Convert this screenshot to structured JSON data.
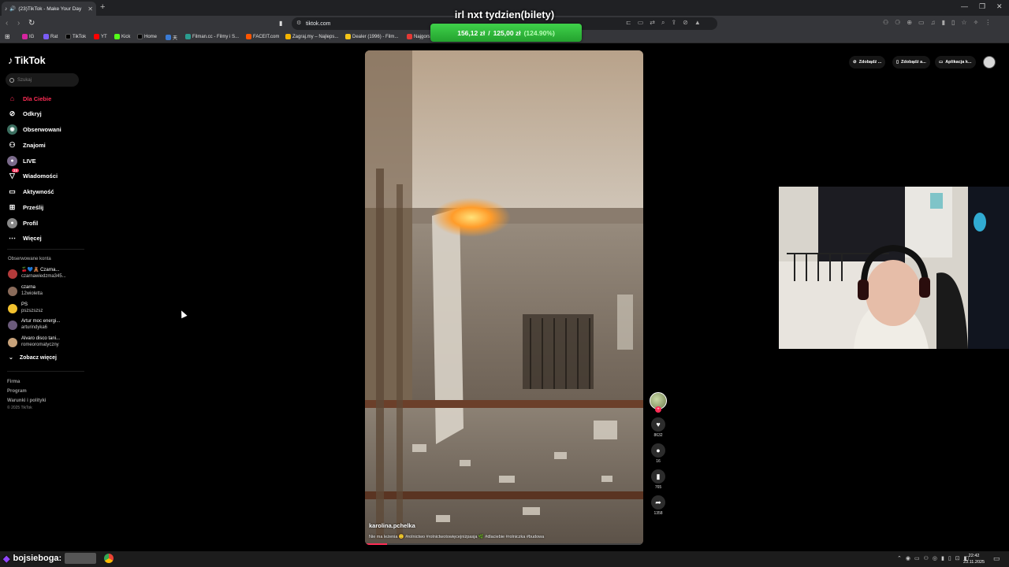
{
  "browser": {
    "tab_title": "(23)TikTok - Make Your Day",
    "url": "tiktok.com",
    "bookmarks": [
      {
        "label": "IG",
        "color": "#d6249f"
      },
      {
        "label": "Rat",
        "color": "#7a5cf5"
      },
      {
        "label": "TikTok",
        "color": "#000000"
      },
      {
        "label": "YT",
        "color": "#ff0000"
      },
      {
        "label": "Kick",
        "color": "#53fc18"
      },
      {
        "label": "Home",
        "color": "#000000"
      },
      {
        "label": "天",
        "color": "#3a7bd5"
      },
      {
        "label": "Filman.cc - Filmy i S...",
        "color": "#2a9d8f"
      },
      {
        "label": "FACEIT.com",
        "color": "#ff5500"
      },
      {
        "label": "Zagraj.my – Najleps...",
        "color": "#f4b400"
      },
      {
        "label": "Dealer (1996) - Film...",
        "color": "#f5c518"
      },
      {
        "label": "Najgors",
        "color": "#e53935"
      }
    ]
  },
  "overlay": {
    "title": "irl nxt tydzien(bilety)",
    "current": "156,12 zł",
    "separator": "/",
    "goal": "125,00 zł",
    "percent": "(124.90%)"
  },
  "tiktok": {
    "logo": "TikTok",
    "search_placeholder": "Szukaj",
    "nav": [
      {
        "label": "Dla Ciebie",
        "icon": "home-icon"
      },
      {
        "label": "Odkryj",
        "icon": "compass-icon"
      },
      {
        "label": "Obserwowani",
        "icon": "following-icon"
      },
      {
        "label": "Znajomi",
        "icon": "friends-icon"
      },
      {
        "label": "LIVE",
        "icon": "live-icon"
      },
      {
        "label": "Wiadomości",
        "icon": "messages-icon",
        "badge": "23"
      },
      {
        "label": "Aktywność",
        "icon": "activity-icon"
      },
      {
        "label": "Prześlij",
        "icon": "upload-icon"
      },
      {
        "label": "Profil",
        "icon": "profile-icon"
      },
      {
        "label": "Więcej",
        "icon": "more-icon"
      }
    ],
    "followed_label": "Obserwowane konta",
    "followed": [
      {
        "name": "🍒💙🧸 Czarna...",
        "handle": "czarnawiedzma345...",
        "color": "#b33a3a"
      },
      {
        "name": "czarna",
        "handle": "12wioletta",
        "color": "#8a6b5a"
      },
      {
        "name": "PS",
        "handle": "pszszszsz",
        "color": "#f2c12e"
      },
      {
        "name": "Artur moc energi...",
        "handle": "arturindyka6",
        "color": "#6b5b7b"
      },
      {
        "name": "Alvaro disco tani...",
        "handle": "romeoromatyczny",
        "color": "#c8a27a"
      }
    ],
    "see_more": "Zobacz więcej",
    "footer": [
      "Firma",
      "Program",
      "Warunki i polityki"
    ],
    "copyright": "© 2025 TikTok",
    "top_right": [
      {
        "label": "Zdobądź ...",
        "icon": "coin-icon"
      },
      {
        "label": "Zdobądź a...",
        "icon": "phone-icon"
      },
      {
        "label": "Aplikacja k...",
        "icon": "monitor-icon"
      }
    ],
    "video": {
      "author": "karolina.pchelka",
      "description": "Nie ma leżenia 🙂      #rolnictwo #rolnictwotowięcejniżpasja 🌿 #dlaciebie #rolniczka #budowa",
      "progress": 0.08
    },
    "actions": {
      "likes": "8632",
      "comments": "16",
      "saves": "765",
      "shares": "1358"
    }
  },
  "taskbar": {
    "user": "bojsieboga:",
    "time": "22:42",
    "date": "23.11.2025"
  }
}
